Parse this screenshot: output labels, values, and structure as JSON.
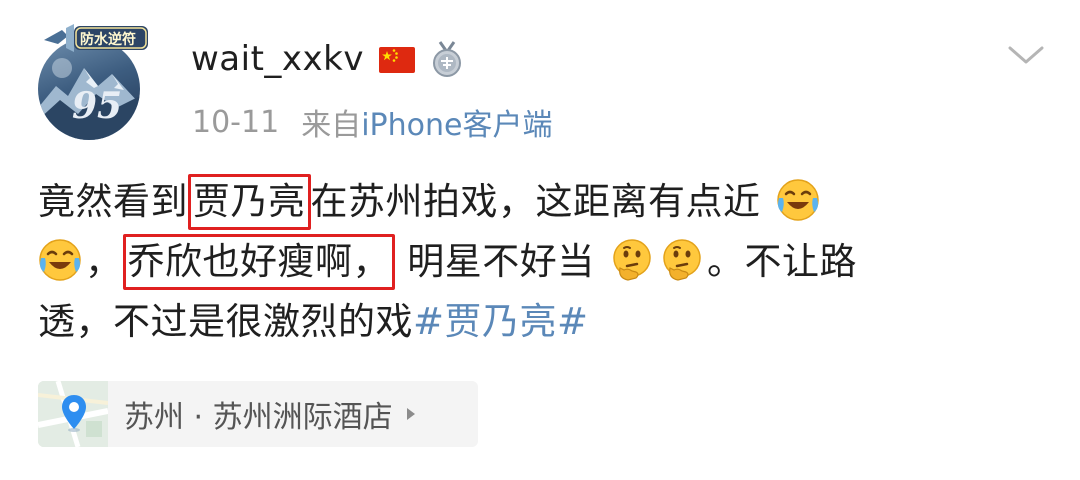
{
  "author": {
    "username": "wait_xxkv",
    "avatar_badge_text": "防水逆符",
    "avatar_number": "95",
    "icons": [
      "china-flag-icon",
      "silver-medal-icon"
    ]
  },
  "meta": {
    "date": "10-11",
    "source_prefix": "来自",
    "source_client": "iPhone客户端"
  },
  "post": {
    "line1_before": "竟然看到",
    "line1_highlight": "贾乃亮",
    "line1_after": "在苏州拍戏，这距离有点近",
    "line2_comma": "，",
    "line2_highlight": "乔欣也好瘦啊，",
    "line2_after": "明星不好当",
    "line2_end": "。不让路",
    "line3_text": "透，不过是很激烈的戏",
    "hashtag": "#贾乃亮#",
    "emoji_names": [
      "laugh-cry-emoji",
      "thinking-emoji"
    ],
    "highlight_color": "#e02020"
  },
  "location": {
    "label": "苏州 · 苏州洲际酒店",
    "icon": "location-pin-icon"
  },
  "colors": {
    "link": "#5b88b8",
    "meta": "#9a9a9a",
    "text": "#1f1f1f"
  }
}
